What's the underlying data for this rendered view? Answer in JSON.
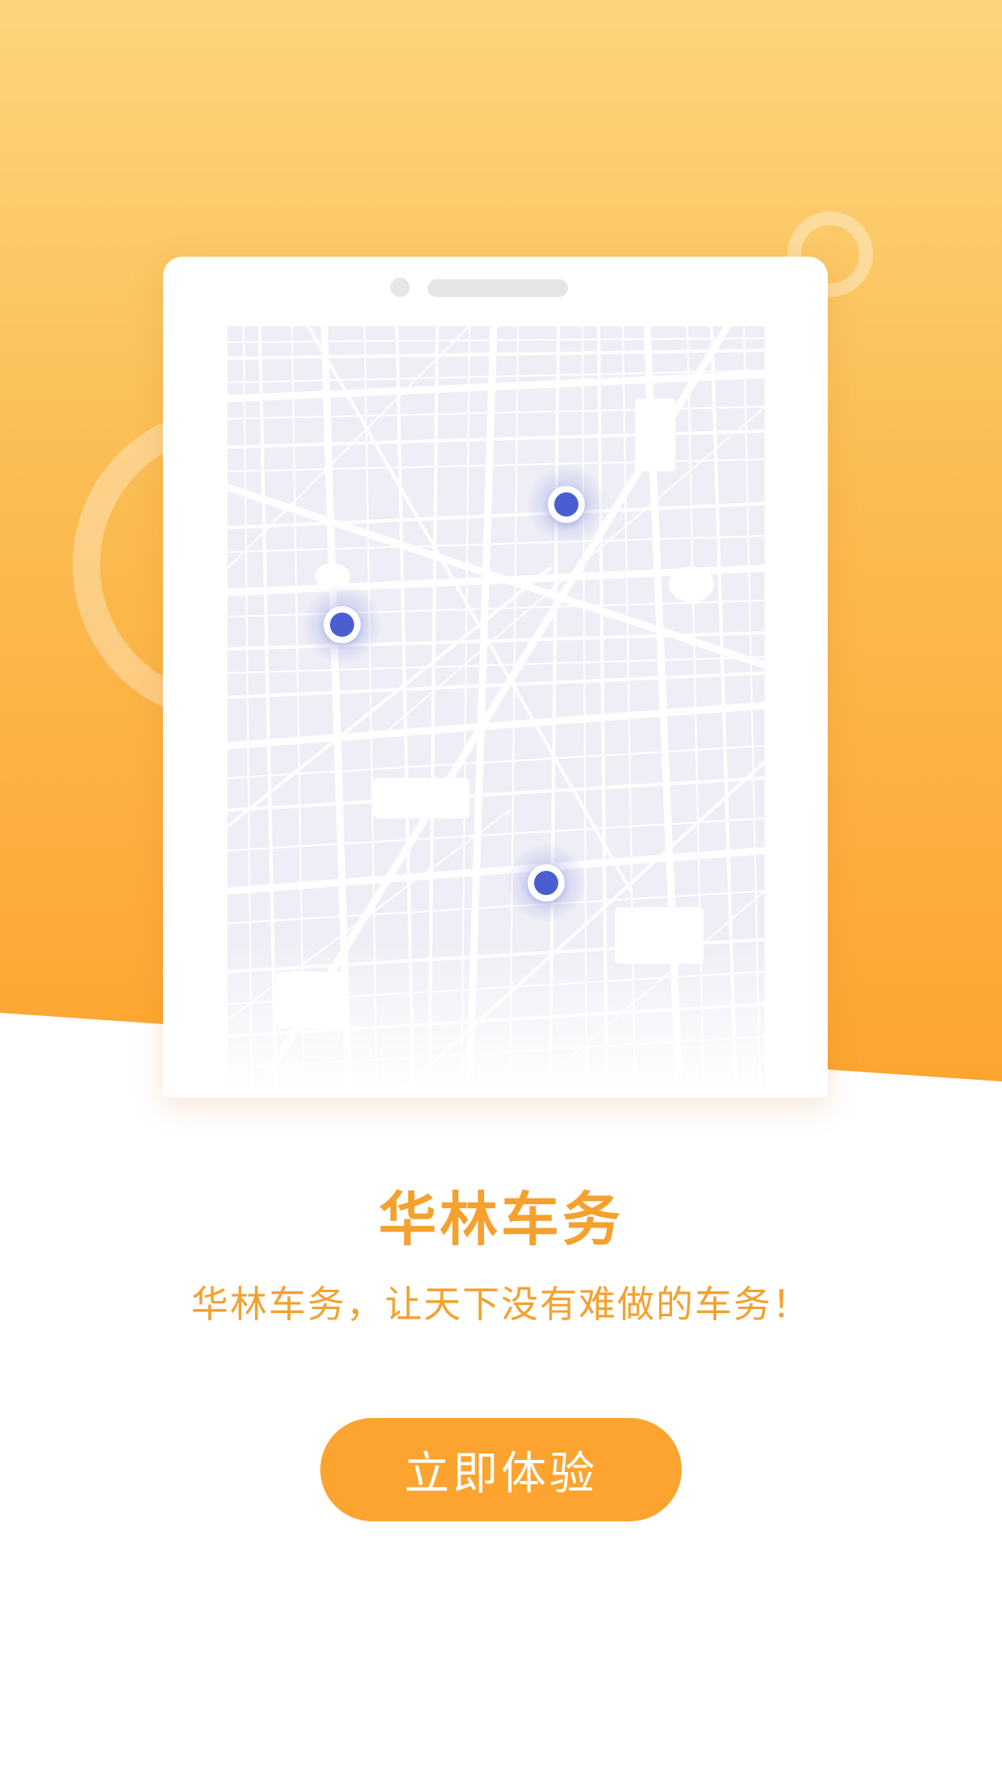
{
  "app": {
    "title": "华林车务",
    "slogan": "华林车务，让天下没有难做的车务！",
    "cta_label": "立即体验"
  },
  "illustration": {
    "map_pins": [
      "location-pin",
      "location-pin",
      "location-pin"
    ]
  },
  "colors": {
    "accent": "#f4a12f",
    "button": "#fca42f",
    "hero_top": "#fcd57b",
    "hero_bottom": "#fda42f",
    "pin": "#4b5ed1"
  }
}
